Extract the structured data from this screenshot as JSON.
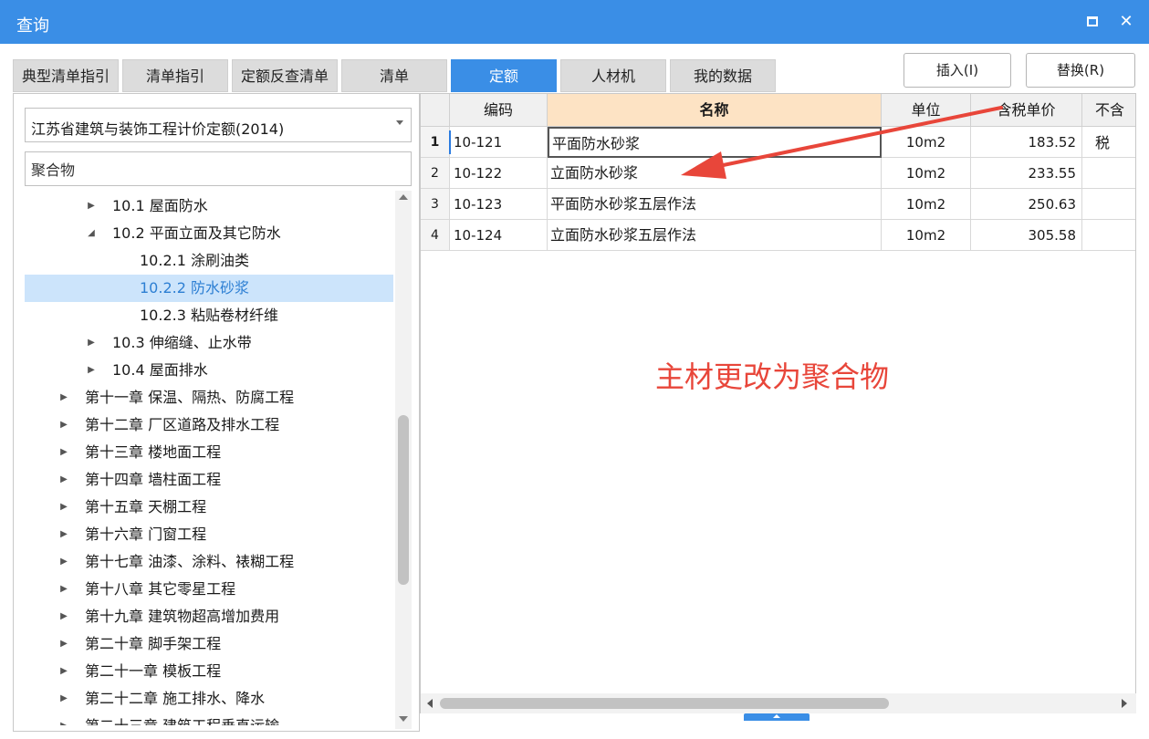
{
  "window": {
    "title": "查询"
  },
  "tabs": [
    {
      "label": "典型清单指引",
      "active": false
    },
    {
      "label": "清单指引",
      "active": false
    },
    {
      "label": "定额反查清单",
      "active": false
    },
    {
      "label": "清单",
      "active": false
    },
    {
      "label": "定额",
      "active": true
    },
    {
      "label": "人材机",
      "active": false
    },
    {
      "label": "我的数据",
      "active": false
    }
  ],
  "actions": {
    "insert_label": "插入(I)",
    "replace_label": "替换(R)"
  },
  "left": {
    "library": "江苏省建筑与装饰工程计价定额(2014)",
    "search_value": "聚合物",
    "tree": [
      {
        "label": "10.1 屋面防水",
        "toggle": "▶"
      },
      {
        "label": "10.2 平面立面及其它防水",
        "toggle": "◢"
      },
      {
        "label": "10.2.1 涂刷油类",
        "toggle": ""
      },
      {
        "label": "10.2.2 防水砂浆",
        "toggle": "",
        "selected": true
      },
      {
        "label": "10.2.3 粘贴卷材纤维",
        "toggle": ""
      },
      {
        "label": "10.3 伸缩缝、止水带",
        "toggle": "▶"
      },
      {
        "label": "10.4 屋面排水",
        "toggle": "▶"
      },
      {
        "label": "第十一章 保温、隔热、防腐工程",
        "toggle": "▶"
      },
      {
        "label": "第十二章 厂区道路及排水工程",
        "toggle": "▶"
      },
      {
        "label": "第十三章 楼地面工程",
        "toggle": "▶"
      },
      {
        "label": "第十四章 墙柱面工程",
        "toggle": "▶"
      },
      {
        "label": "第十五章 天棚工程",
        "toggle": "▶"
      },
      {
        "label": "第十六章 门窗工程",
        "toggle": "▶"
      },
      {
        "label": "第十七章 油漆、涂料、裱糊工程",
        "toggle": "▶"
      },
      {
        "label": "第十八章 其它零星工程",
        "toggle": "▶"
      },
      {
        "label": "第十九章 建筑物超高增加费用",
        "toggle": "▶"
      },
      {
        "label": "第二十章 脚手架工程",
        "toggle": "▶"
      },
      {
        "label": "第二十一章 模板工程",
        "toggle": "▶"
      },
      {
        "label": "第二十二章 施工排水、降水",
        "toggle": "▶"
      },
      {
        "label": "第二十三章 建筑工程垂直运输",
        "toggle": "▶"
      }
    ]
  },
  "table": {
    "columns": [
      "编码",
      "名称",
      "单位",
      "含税单价",
      "不含税"
    ],
    "rows": [
      {
        "num": "1",
        "code": "10-121",
        "name": "平面防水砂浆",
        "unit": "10m2",
        "price": "183.52"
      },
      {
        "num": "2",
        "code": "10-122",
        "name": "立面防水砂浆",
        "unit": "10m2",
        "price": "233.55"
      },
      {
        "num": "3",
        "code": "10-123",
        "name": "平面防水砂浆五层作法",
        "unit": "10m2",
        "price": "250.63"
      },
      {
        "num": "4",
        "code": "10-124",
        "name": "立面防水砂浆五层作法",
        "unit": "10m2",
        "price": "305.58"
      }
    ]
  },
  "annotation": {
    "text": "主材更改为聚合物",
    "color": "#e8463a"
  },
  "colors": {
    "accent": "#3a8ee6",
    "header_highlight": "#fde3c4",
    "selection": "#cce4fb"
  }
}
